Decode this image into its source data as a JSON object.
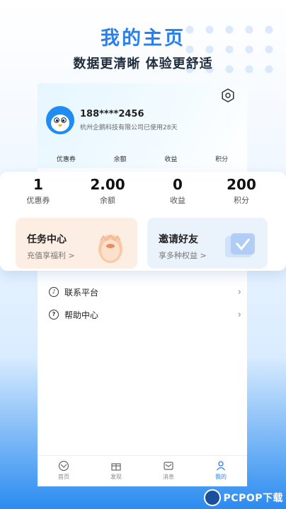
{
  "header": {
    "title": "我的主页",
    "subtitle": "数据更清晰 体验更舒适"
  },
  "profile": {
    "phone": "188****2456",
    "company": "杭州企鹅科技有限公司已使用28天"
  },
  "mini_labels": [
    "优惠券",
    "余额",
    "收益",
    "积分"
  ],
  "stats": [
    {
      "value": "1",
      "label": "优惠券"
    },
    {
      "value": "2.00",
      "label": "余额"
    },
    {
      "value": "0",
      "label": "收益"
    },
    {
      "value": "200",
      "label": "积分"
    }
  ],
  "cards": {
    "task": {
      "title": "任务中心",
      "subtitle": "充值享福利 >"
    },
    "invite": {
      "title": "邀请好友",
      "subtitle": "享多种权益 >"
    }
  },
  "menu": [
    {
      "label": "联系平台",
      "icon": "headset-icon"
    },
    {
      "label": "帮助中心",
      "icon": "help-icon"
    }
  ],
  "tabs": [
    {
      "label": "首页",
      "icon": "home-icon",
      "active": false
    },
    {
      "label": "发现",
      "icon": "gift-icon",
      "active": false
    },
    {
      "label": "消息",
      "icon": "message-icon",
      "active": false
    },
    {
      "label": "我的",
      "icon": "user-icon",
      "active": true
    }
  ],
  "watermark": "PCPOP下载",
  "colors": {
    "accent": "#2a7fea",
    "task_card": "#fdeee3",
    "invite_card": "#eaf2fc"
  }
}
